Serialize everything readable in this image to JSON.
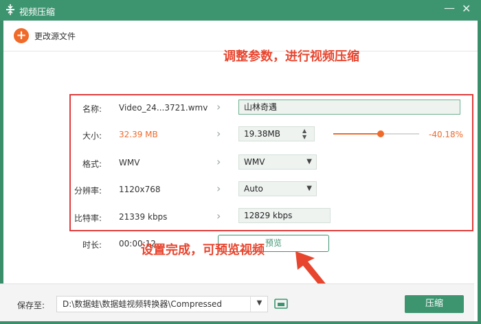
{
  "window": {
    "title": "视频压缩",
    "minimize": "—",
    "close": "✕"
  },
  "toolbar": {
    "change_source": "更改源文件"
  },
  "annotations": {
    "top": "调整参数，进行视频压缩",
    "bottom": "设置完成，可预览视频"
  },
  "fields": {
    "name": {
      "label": "名称:",
      "source": "Video_24...3721.wmv",
      "value": "山林奇遇"
    },
    "size": {
      "label": "大小:",
      "source": "32.39 MB",
      "value": "19.38MB",
      "percent": "-40.18%",
      "slider_fraction": 0.55
    },
    "format": {
      "label": "格式:",
      "source": "WMV",
      "value": "WMV"
    },
    "resolution": {
      "label": "分辨率:",
      "source": "1120x768",
      "value": "Auto"
    },
    "bitrate": {
      "label": "比特率:",
      "source": "21339 kbps",
      "value": "12829 kbps"
    },
    "duration": {
      "label": "时长:",
      "source": "00:00:12"
    }
  },
  "preview_button": "预览",
  "footer": {
    "save_label": "保存至:",
    "path": "D:\\数据蛙\\数据蛙视频转换器\\Compressed",
    "compress_button": "压缩"
  },
  "colors": {
    "accent": "#3d9570",
    "orange": "#f06a2a",
    "annotation": "#e8452e",
    "redbox": "#e13a3a"
  }
}
